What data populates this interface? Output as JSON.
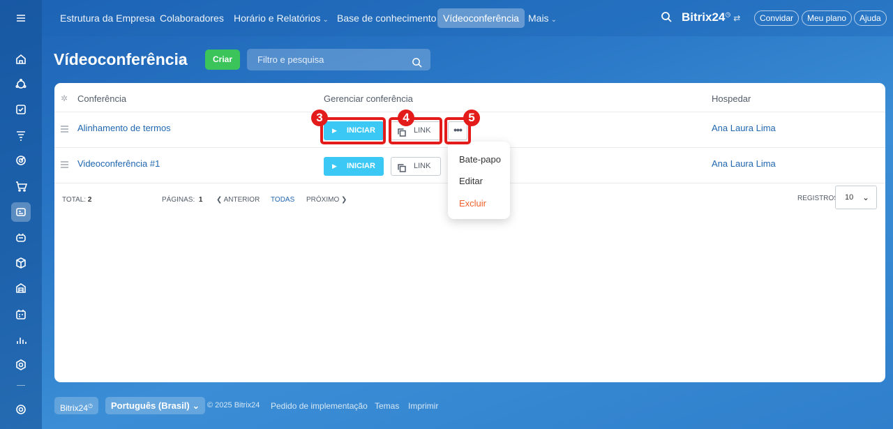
{
  "nav": {
    "items": [
      {
        "label": "Estrutura da Empresa",
        "chev": ""
      },
      {
        "label": "Colaboradores",
        "chev": ""
      },
      {
        "label": "Horário e Relatórios",
        "chev": "⌄"
      },
      {
        "label": "Base de conhecimento",
        "chev": ""
      },
      {
        "label": "Vídeoconferência",
        "chev": ""
      },
      {
        "label": "Mais",
        "chev": "⌄"
      }
    ],
    "brand": "Bitrix",
    "brand_num": "24",
    "brand_mark": "◷",
    "brand_toggle": "⇄",
    "invite": "Convidar",
    "plan": "Meu plano",
    "help": "Ajuda"
  },
  "page": {
    "title": "Vídeoconferência",
    "pin_icon": "✩",
    "create_label": "Criar",
    "filter_placeholder": "Filtro e pesquisa"
  },
  "table": {
    "headers": {
      "conference": "Conferência",
      "manage": "Gerenciar conferência",
      "host": "Hospedar"
    },
    "rows": [
      {
        "name": "Alinhamento de termos",
        "start": "INICIAR",
        "link": "LINK",
        "more": "•••",
        "host": "Ana Laura Lima"
      },
      {
        "name": "Videoconferência #1",
        "start": "INICIAR",
        "link": "LINK",
        "host": "Ana Laura Lima"
      }
    ],
    "footer": {
      "total_label": "TOTAL:",
      "total_value": "2",
      "pages_label": "PÁGINAS:",
      "pages_value": "1",
      "prev": "ANTERIOR",
      "all": "TODAS",
      "next": "PRÓXIMO",
      "records_label": "REGISTROS:",
      "records_value": "10"
    }
  },
  "menu": {
    "items": [
      {
        "label": "Bate-papo"
      },
      {
        "label": "Editar"
      },
      {
        "label": "Excluir"
      }
    ]
  },
  "annotations": {
    "badges": [
      "3",
      "4",
      "5"
    ],
    "color": "#e31b1b"
  },
  "footer": {
    "brand": "Bitrix24",
    "brand_mark": "◷",
    "language": "Português (Brasil)",
    "copyright": "© 2025 Bitrix24",
    "implementation": "Pedido de implementação",
    "themes": "Temas",
    "print": "Imprimir"
  },
  "colors": {
    "accent_blue": "#2067b0",
    "start_button": "#3bc8f5",
    "create_button": "#3bc45a",
    "delete_text": "#f05f2b"
  }
}
